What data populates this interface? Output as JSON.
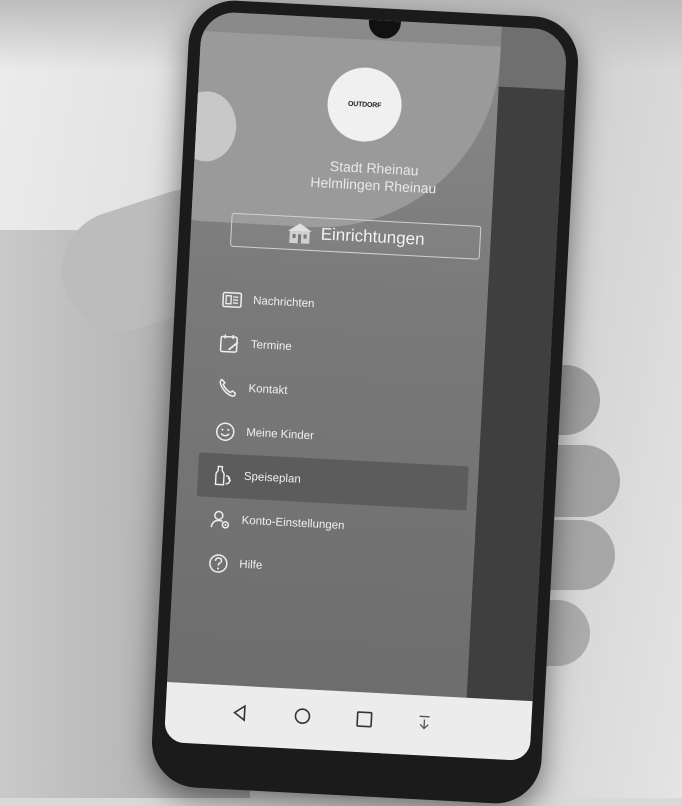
{
  "status_bar": {
    "left": "",
    "right": ""
  },
  "header": {
    "logo_text": "OUTDORF",
    "org_line1": "Stadt Rheinau",
    "org_line2": "Helmlingen Rheinau"
  },
  "facility_button": {
    "label": "Einrichtungen",
    "icon": "building-icon"
  },
  "menu": {
    "items": [
      {
        "label": "Nachrichten",
        "icon": "news-icon"
      },
      {
        "label": "Termine",
        "icon": "calendar-edit-icon"
      },
      {
        "label": "Kontakt",
        "icon": "phone-icon"
      },
      {
        "label": "Meine Kinder",
        "icon": "smiley-icon"
      },
      {
        "label": "Speiseplan",
        "icon": "food-menu-icon"
      },
      {
        "label": "Konto-Einstellungen",
        "icon": "user-settings-icon"
      },
      {
        "label": "Hilfe",
        "icon": "help-icon"
      }
    ],
    "active_index": 4
  },
  "navbar": {
    "buttons": [
      "back-icon",
      "home-icon",
      "recents-icon",
      "download-icon"
    ]
  },
  "colors": {
    "drawer": "#7a7a7a",
    "active_item": "#5c5c5c",
    "text": "#f0f0f0"
  }
}
